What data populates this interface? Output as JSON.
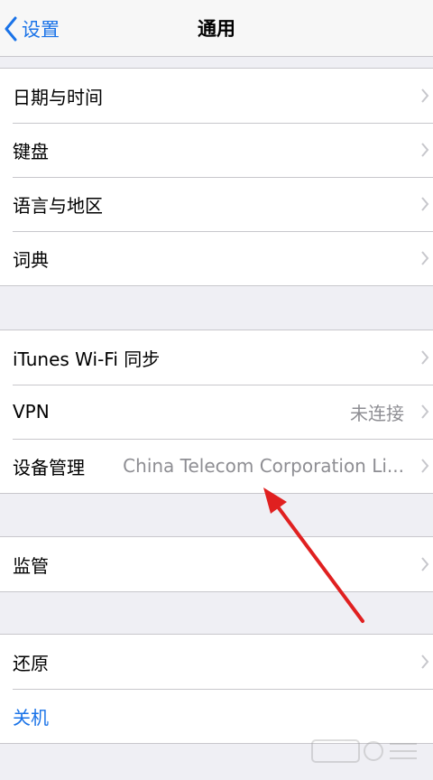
{
  "navbar": {
    "back_label": "设置",
    "title": "通用"
  },
  "groups": [
    {
      "rows": [
        {
          "label": "日期与时间",
          "value": ""
        },
        {
          "label": "键盘",
          "value": ""
        },
        {
          "label": "语言与地区",
          "value": ""
        },
        {
          "label": "词典",
          "value": ""
        }
      ]
    },
    {
      "rows": [
        {
          "label": "iTunes Wi-Fi 同步",
          "value": ""
        },
        {
          "label": "VPN",
          "value": "未连接"
        },
        {
          "label": "设备管理",
          "value": "China Telecom Corporation Li..."
        }
      ]
    },
    {
      "rows": [
        {
          "label": "监管",
          "value": ""
        }
      ]
    },
    {
      "rows": [
        {
          "label": "还原",
          "value": ""
        },
        {
          "label": "关机",
          "value": ""
        }
      ]
    }
  ],
  "icons": {
    "back": "chevron-left-icon",
    "disclosure": "chevron-right-icon",
    "annotation": "red-arrow-annotation",
    "watermark": "baidu-jingyan-watermark"
  },
  "colors": {
    "accent": "#1a73e8",
    "annotation": "#e02020",
    "secondary_text": "#8e8e93",
    "chevron": "#c7c7cc",
    "background": "#efeff4"
  }
}
